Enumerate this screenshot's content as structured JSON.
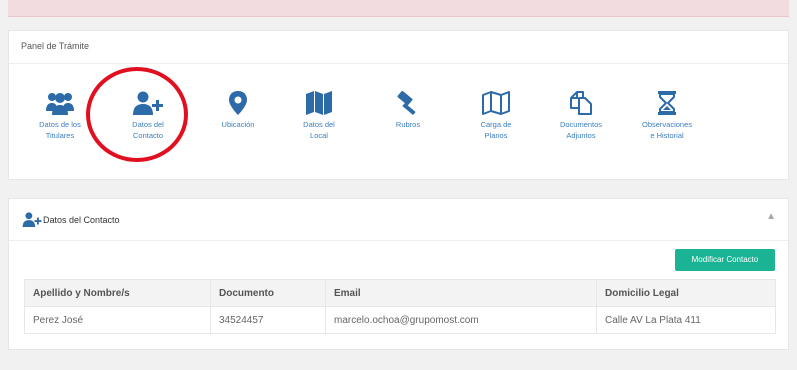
{
  "panel_tramite": {
    "title": "Panel de Trámite",
    "items": [
      {
        "label": "Datos de los\nTitulares",
        "icon": "users-icon"
      },
      {
        "label": "Datos del\nContacto",
        "icon": "user-plus-icon"
      },
      {
        "label": "Ubicación",
        "icon": "map-marker-icon"
      },
      {
        "label": "Datos del\nLocal",
        "icon": "map-icon"
      },
      {
        "label": "Rubros",
        "icon": "gavel-icon"
      },
      {
        "label": "Carga de\nPlanos",
        "icon": "map-outline-icon"
      },
      {
        "label": "Documentos\nAdjuntos",
        "icon": "copy-documents-icon"
      },
      {
        "label": "Observaciones\ne Historial",
        "icon": "hourglass-icon"
      }
    ]
  },
  "datos_contacto": {
    "title": "Datos del Contacto",
    "icon": "user-plus-icon",
    "modify_label": "Modificar Contacto",
    "columns": [
      "Apellido y Nombre/s",
      "Documento",
      "Email",
      "Domicilio Legal"
    ],
    "rows": [
      [
        "Perez José",
        "34524457",
        "marcelo.ochoa@grupomost.com",
        "Calle AV La Plata 411"
      ]
    ]
  },
  "colors": {
    "icon_blue": "#2c6aa8",
    "label_blue": "#3d7ebd",
    "button_green": "#1ab394",
    "highlight_red": "#e01020",
    "alert_pink": "#f2dcdf"
  }
}
